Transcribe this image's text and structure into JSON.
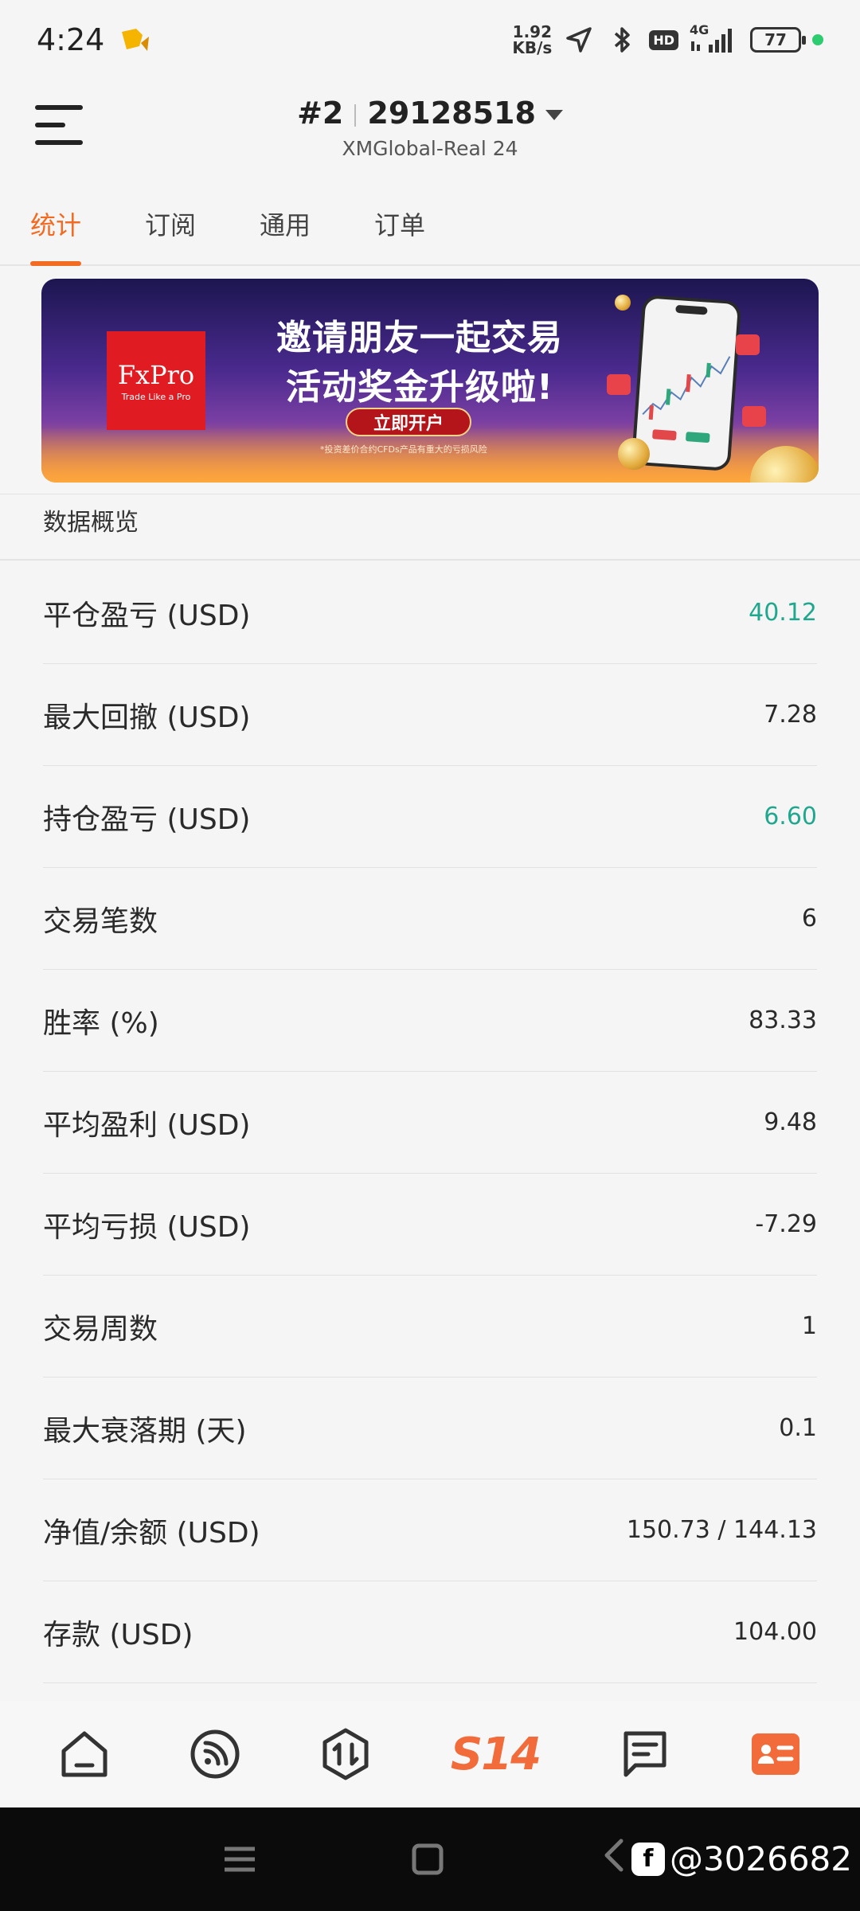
{
  "status_bar": {
    "time": "4:24",
    "net_speed_value": "1.92",
    "net_speed_unit": "KB/s",
    "network": "4G",
    "hd": "HD",
    "battery": "77"
  },
  "header": {
    "account_index": "#2",
    "account_number": "29128518",
    "server": "XMGlobal-Real 24"
  },
  "tabs": [
    {
      "label": "统计",
      "active": true
    },
    {
      "label": "订阅",
      "active": false
    },
    {
      "label": "通用",
      "active": false
    },
    {
      "label": "订单",
      "active": false
    }
  ],
  "banner": {
    "brand": "FxPro",
    "brand_tagline": "Trade Like a Pro",
    "line1": "邀请朋友一起交易",
    "line2": "活动奖金升级啦!",
    "cta": "立即开户",
    "disclaimer": "*投资差价合约CFDs产品有重大的亏损风险"
  },
  "section": {
    "title": "数据概览"
  },
  "stats": [
    {
      "label": "平仓盈亏 (USD)",
      "value": "40.12",
      "positive": true
    },
    {
      "label": "最大回撤 (USD)",
      "value": "7.28",
      "positive": false
    },
    {
      "label": "持仓盈亏 (USD)",
      "value": "6.60",
      "positive": true
    },
    {
      "label": "交易笔数",
      "value": "6",
      "positive": false
    },
    {
      "label": "胜率 (%)",
      "value": "83.33",
      "positive": false
    },
    {
      "label": "平均盈利 (USD)",
      "value": "9.48",
      "positive": false
    },
    {
      "label": "平均亏损 (USD)",
      "value": "-7.29",
      "positive": false
    },
    {
      "label": "交易周数",
      "value": "1",
      "positive": false
    },
    {
      "label": "最大衰落期 (天)",
      "value": "0.1",
      "positive": false
    },
    {
      "label": "净值/余额 (USD)",
      "value": "150.73 / 144.13",
      "positive": false
    },
    {
      "label": "存款 (USD)",
      "value": "104.00",
      "positive": false
    }
  ],
  "bottom_nav": {
    "items": [
      "home-icon",
      "signal-icon",
      "trade-icon",
      "s14-logo",
      "message-icon",
      "profile-card-icon"
    ],
    "s14_label": "S14",
    "accent": "#f26b3a"
  },
  "watermark": {
    "text": "@3026682"
  }
}
